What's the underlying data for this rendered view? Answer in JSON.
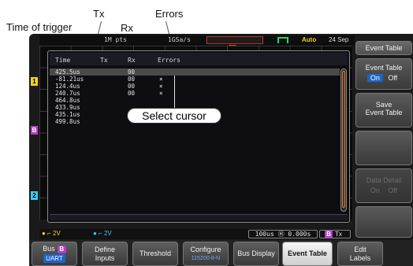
{
  "annotations": {
    "time_of_trigger": "Time of trigger",
    "tx": "Tx",
    "rx": "Rx",
    "errors": "Errors",
    "select_cursor": "Select cursor"
  },
  "top_bar": {
    "record_length": "1M pts",
    "sample_rate": "1GSa/s",
    "trigger_mode": "Auto",
    "date": "24 Sep",
    "accent_trigger": "#e34a1c",
    "accent_auto": "#f2d21b"
  },
  "event_table": {
    "columns": [
      "Time",
      "Tx",
      "Rx",
      "Errors"
    ],
    "rows": [
      {
        "time": "425.5us",
        "tx": "",
        "rx": "00",
        "errors": ""
      },
      {
        "time": "-81.21us",
        "tx": "",
        "rx": "00",
        "errors": "×"
      },
      {
        "time": "124.4us",
        "tx": "",
        "rx": "00",
        "errors": "×"
      },
      {
        "time": "240.7us",
        "tx": "",
        "rx": "00",
        "errors": "×"
      },
      {
        "time": "464.8us",
        "tx": "",
        "rx": "",
        "errors": ""
      },
      {
        "time": "433.9us",
        "tx": "",
        "rx": "",
        "errors": ""
      },
      {
        "time": "435.1us",
        "tx": "",
        "rx": "",
        "errors": ""
      },
      {
        "time": "499.8us",
        "tx": "",
        "rx": "",
        "errors": ""
      }
    ],
    "selected_row": 0
  },
  "status_bar": {
    "ch1": "2V",
    "ch2": "2V",
    "timebase": "100us",
    "position": "0.000s",
    "bus": "B",
    "bus_source": "Tx",
    "ch1_color": "#f2d21b",
    "ch2_color": "#3cc8f0"
  },
  "side_menu": {
    "title": "Event Table",
    "event_table_label": "Event Table",
    "on": "On",
    "off": "Off",
    "save_line1": "Save",
    "save_line2": "Event Table",
    "data_detail": "Data Detail",
    "dd_on": "On",
    "dd_off": "Off"
  },
  "bottom_menu": {
    "bus_label": "Bus",
    "bus_id": "B",
    "bus_type": "UART",
    "define_line1": "Define",
    "define_line2": "Inputs",
    "threshold": "Threshold",
    "configure": "Configure",
    "configure_sub": "115200-8-N",
    "bus_display": "Bus Display",
    "event_table": "Event Table",
    "edit_line1": "Edit",
    "edit_line2": "Labels"
  },
  "channel_markers": [
    "1",
    "2",
    "B",
    "B"
  ]
}
